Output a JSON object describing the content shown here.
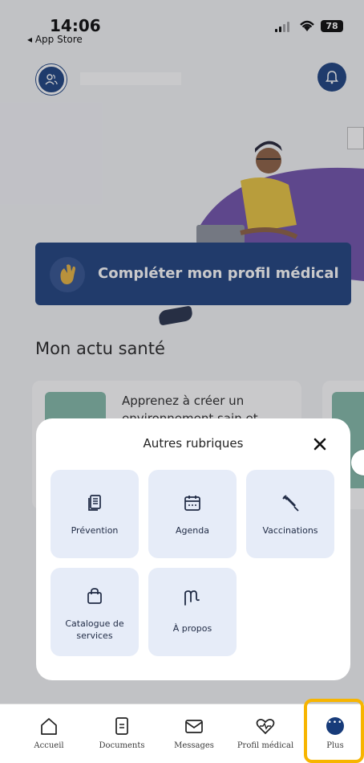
{
  "status_bar": {
    "time": "14:06",
    "back_label": "◂ App Store",
    "battery": "78"
  },
  "header": {
    "avatar_icon": "users-icon",
    "bell_icon": "bell-icon"
  },
  "banner": {
    "label": "Compléter mon profil médical",
    "icon": "waving-hand-icon"
  },
  "main": {
    "section_title": "Mon actu santé",
    "news_card_text": "Apprenez à créer un environnement sain et"
  },
  "modal": {
    "title": "Autres rubriques",
    "tiles": [
      {
        "label": "Prévention",
        "icon": "document-stack-icon"
      },
      {
        "label": "Agenda",
        "icon": "calendar-icon"
      },
      {
        "label": "Vaccinations",
        "icon": "syringe-icon"
      },
      {
        "label": "Catalogue de services",
        "icon": "shopping-bag-icon"
      },
      {
        "label": "À propos",
        "icon": "m-logo-icon"
      }
    ]
  },
  "bottom_nav": {
    "items": [
      {
        "label": "Accueil",
        "icon": "home-icon"
      },
      {
        "label": "Documents",
        "icon": "document-icon"
      },
      {
        "label": "Messages",
        "icon": "mail-icon"
      },
      {
        "label": "Profil médical",
        "icon": "heart-pulse-icon"
      },
      {
        "label": "Plus",
        "icon": "more-dots-icon"
      }
    ],
    "highlight_color": "#f7b500",
    "accent_color": "#173b7a"
  }
}
